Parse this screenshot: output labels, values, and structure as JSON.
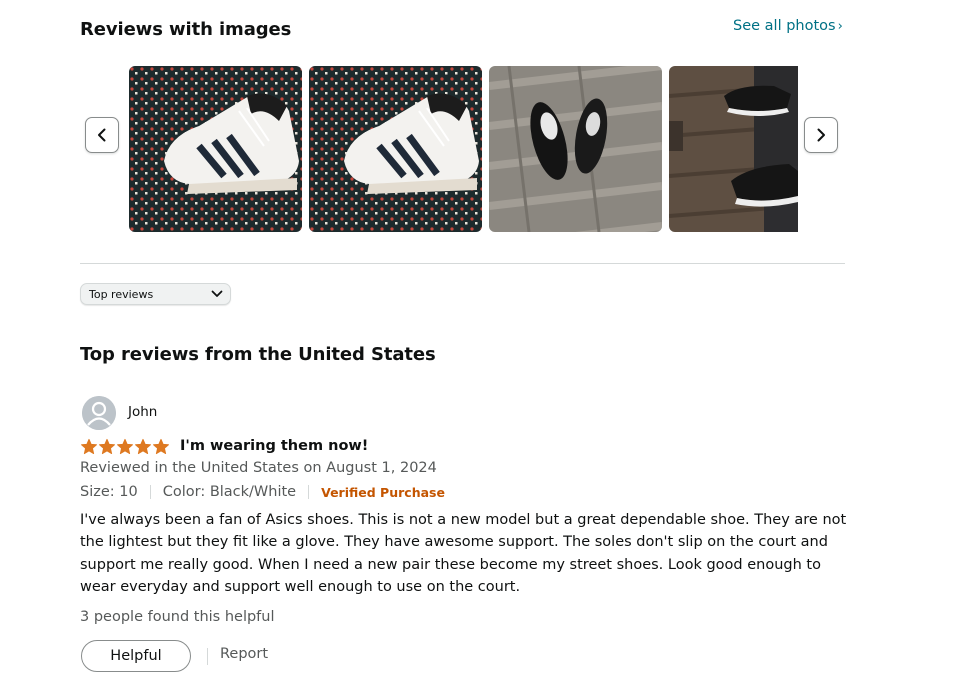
{
  "images_section": {
    "title": "Reviews with images",
    "see_all_label": "See all photos",
    "see_all_chevron": "›",
    "prev_icon": "chevron-left-icon",
    "next_icon": "chevron-right-icon",
    "thumbnails": [
      {
        "icon": "shoe-photo-1"
      },
      {
        "icon": "shoe-photo-2"
      },
      {
        "icon": "shoe-photo-3"
      },
      {
        "icon": "shoe-photo-4"
      }
    ]
  },
  "sort": {
    "selected": "Top reviews",
    "icon": "chevron-down-icon"
  },
  "reviews_section": {
    "title": "Top reviews from the United States"
  },
  "review": {
    "reviewer": "John",
    "rating": 5,
    "rating_max": 5,
    "star_color": "#de7921",
    "title": "I'm wearing them now!",
    "date_line": "Reviewed in the United States on August 1, 2024",
    "size": "Size: 10",
    "color": "Color: Black/White",
    "verified": "Verified Purchase",
    "body": "I've always been a fan of Asics shoes. This is not a new model but a great dependable shoe. They are not the lightest but they fit like a glove. They have awesome support. The soles don't slip on the court and support me really good. When I need a new pair these become my street shoes. Look good enough to wear everyday and support well enough to use on the court.",
    "helpful_count": "3 people found this helpful",
    "helpful_label": "Helpful",
    "report_label": "Report"
  }
}
